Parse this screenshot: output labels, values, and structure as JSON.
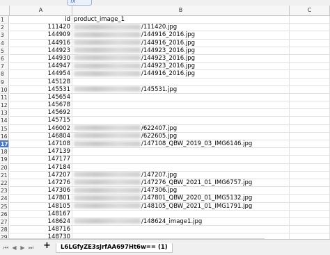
{
  "formula_bar": {
    "fx_label": "fx"
  },
  "columns": [
    "A",
    "B",
    "C"
  ],
  "rows": [
    {
      "num": "1",
      "a": "id",
      "b": "product_image_1",
      "blur": false
    },
    {
      "num": "2",
      "a": "111420",
      "b": "/111420.jpg",
      "blur": true
    },
    {
      "num": "3",
      "a": "144909",
      "b": "/144916_2016.jpg",
      "blur": true
    },
    {
      "num": "4",
      "a": "144916",
      "b": "/144916_2016.jpg",
      "blur": true
    },
    {
      "num": "5",
      "a": "144923",
      "b": "/144923_2016.jpg",
      "blur": true
    },
    {
      "num": "6",
      "a": "144930",
      "b": "/144923_2016.jpg",
      "blur": true
    },
    {
      "num": "7",
      "a": "144947",
      "b": "/144923_2016.jpg",
      "blur": true
    },
    {
      "num": "8",
      "a": "144954",
      "b": "/144916_2016.jpg",
      "blur": true
    },
    {
      "num": "9",
      "a": "145128",
      "b": "",
      "blur": false
    },
    {
      "num": "10",
      "a": "145531",
      "b": "/145531.jpg",
      "blur": true
    },
    {
      "num": "11",
      "a": "145654",
      "b": "",
      "blur": false
    },
    {
      "num": "12",
      "a": "145678",
      "b": "",
      "blur": false
    },
    {
      "num": "13",
      "a": "145692",
      "b": "",
      "blur": false
    },
    {
      "num": "14",
      "a": "145715",
      "b": "",
      "blur": false
    },
    {
      "num": "15",
      "a": "146002",
      "b": "/622407.jpg",
      "blur": true
    },
    {
      "num": "16",
      "a": "146804",
      "b": "/622605.jpg",
      "blur": true
    },
    {
      "num": "17",
      "a": "147108",
      "b": "/147108_QBW_2019_03_IMG6146.jpg",
      "blur": true,
      "active": true
    },
    {
      "num": "18",
      "a": "147139",
      "b": "",
      "blur": false
    },
    {
      "num": "19",
      "a": "147177",
      "b": "",
      "blur": false
    },
    {
      "num": "20",
      "a": "147184",
      "b": "",
      "blur": false
    },
    {
      "num": "21",
      "a": "147207",
      "b": "/147207.jpg",
      "blur": true
    },
    {
      "num": "22",
      "a": "147276",
      "b": "/147276_QBW_2021_01_IMG6757.jpg",
      "blur": true
    },
    {
      "num": "23",
      "a": "147306",
      "b": "/147306.jpg",
      "blur": true
    },
    {
      "num": "24",
      "a": "147801",
      "b": "/147801_QBW_2020_01_IMG5132.jpg",
      "blur": true
    },
    {
      "num": "25",
      "a": "148105",
      "b": "/148105_QBW_2021_01_IMG1791.jpg",
      "blur": true
    },
    {
      "num": "26",
      "a": "148167",
      "b": "",
      "blur": false
    },
    {
      "num": "27",
      "a": "148624",
      "b": "/148624_image1.jpg",
      "blur": true
    },
    {
      "num": "28",
      "a": "148716",
      "b": "",
      "blur": false
    },
    {
      "num": "29",
      "a": "148730",
      "b": "",
      "blur": false
    }
  ],
  "sheet_tab": {
    "label": "L6LGfyZE3sJrfAA697Ht6w== (1)"
  },
  "nav": {
    "add_label": "+"
  }
}
